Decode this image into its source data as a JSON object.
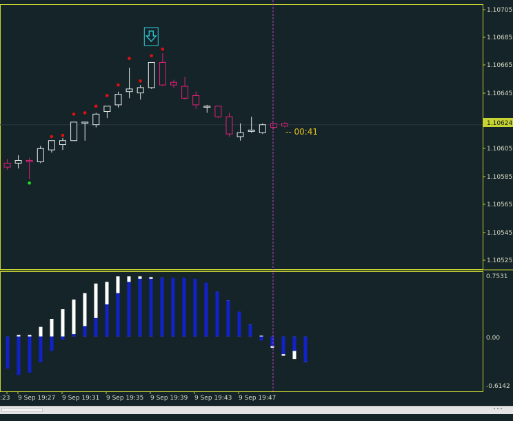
{
  "colors": {
    "background": "#152428",
    "frame": "#c8d432",
    "axis_text": "#d8dcc8",
    "bull": "#e8ecec",
    "bear": "#e0207a",
    "dot_red": "#e01010",
    "dot_green": "#20e020",
    "cursor": "#c040c0",
    "countdown": "#e0c020",
    "price_tag_bg": "#c8d432",
    "price_tag_text": "#0a1418",
    "hist_blue": "#1022c8",
    "hist_white": "#ffffff",
    "arrow": "#30d0e0"
  },
  "price_axis": {
    "labels": [
      "1.10705",
      "1.10685",
      "1.10665",
      "1.10645",
      "1.10624",
      "1.10605",
      "1.10585",
      "1.10565",
      "1.10545",
      "1.10525"
    ],
    "min": 1.10515,
    "max": 1.10715,
    "current_price": "1.10624",
    "current_value": 1.10624
  },
  "indicator_axis": {
    "labels": [
      "0.7531",
      "0.00",
      "-0.6142"
    ],
    "max": 0.7531,
    "min": -0.6142
  },
  "time_axis": {
    "labels": [
      ":23",
      "9 Sep 19:27",
      "9 Sep 19:31",
      "9 Sep 19:35",
      "9 Sep 19:39",
      "9 Sep 19:43",
      "9 Sep 19:47"
    ]
  },
  "countdown": "-- 00:41",
  "signal": {
    "type": "sell",
    "icon": "down-arrow-icon",
    "bar_index": 13
  },
  "candles": [
    {
      "o": 1.10595,
      "h": 1.10598,
      "l": 1.1059,
      "c": 1.10592
    },
    {
      "o": 1.10595,
      "h": 1.10601,
      "l": 1.10591,
      "c": 1.10597
    },
    {
      "o": 1.10597,
      "h": 1.10599,
      "l": 1.10583,
      "c": 1.10596
    },
    {
      "o": 1.10596,
      "h": 1.10608,
      "l": 1.10595,
      "c": 1.10606
    },
    {
      "o": 1.10605,
      "h": 1.10612,
      "l": 1.10603,
      "c": 1.10612
    },
    {
      "o": 1.10609,
      "h": 1.10614,
      "l": 1.10605,
      "c": 1.10612
    },
    {
      "o": 1.10612,
      "h": 1.10626,
      "l": 1.10612,
      "c": 1.10626
    },
    {
      "o": 1.10626,
      "h": 1.10626,
      "l": 1.10612,
      "c": 1.10626
    },
    {
      "o": 1.10624,
      "h": 1.10633,
      "l": 1.10622,
      "c": 1.10632
    },
    {
      "o": 1.10634,
      "h": 1.10638,
      "l": 1.10629,
      "c": 1.10638
    },
    {
      "o": 1.10639,
      "h": 1.10649,
      "l": 1.10637,
      "c": 1.10647
    },
    {
      "o": 1.10649,
      "h": 1.10667,
      "l": 1.10644,
      "c": 1.10651
    },
    {
      "o": 1.10648,
      "h": 1.10654,
      "l": 1.10643,
      "c": 1.10652
    },
    {
      "o": 1.10652,
      "h": 1.10671,
      "l": 1.10651,
      "c": 1.10671
    },
    {
      "o": 1.10671,
      "h": 1.10678,
      "l": 1.10653,
      "c": 1.10654
    },
    {
      "o": 1.10656,
      "h": 1.10658,
      "l": 1.10652,
      "c": 1.10654
    },
    {
      "o": 1.10653,
      "h": 1.1066,
      "l": 1.10643,
      "c": 1.10644
    },
    {
      "o": 1.10646,
      "h": 1.10649,
      "l": 1.10636,
      "c": 1.10639
    },
    {
      "o": 1.10638,
      "h": 1.10639,
      "l": 1.10633,
      "c": 1.10638
    },
    {
      "o": 1.10638,
      "h": 1.10638,
      "l": 1.10629,
      "c": 1.1063
    },
    {
      "o": 1.1063,
      "h": 1.10633,
      "l": 1.10615,
      "c": 1.10617
    },
    {
      "o": 1.10615,
      "h": 1.10625,
      "l": 1.10612,
      "c": 1.10618
    },
    {
      "o": 1.10619,
      "h": 1.1063,
      "l": 1.10618,
      "c": 1.1062
    },
    {
      "o": 1.10618,
      "h": 1.10625,
      "l": 1.10617,
      "c": 1.10624
    },
    {
      "o": 1.10625,
      "h": 1.10625,
      "l": 1.10621,
      "c": 1.10622
    },
    {
      "o": 1.10625,
      "h": 1.10626,
      "l": 1.10622,
      "c": 1.10623
    }
  ],
  "dots": [
    {
      "i": 1,
      "price": 1.1058,
      "color": "green"
    },
    {
      "i": 3,
      "price": 1.10615,
      "color": "red"
    },
    {
      "i": 4,
      "price": 1.10616,
      "color": "red"
    },
    {
      "i": 5,
      "price": 1.10632,
      "color": "red"
    },
    {
      "i": 6,
      "price": 1.10633,
      "color": "red"
    },
    {
      "i": 7,
      "price": 1.10638,
      "color": "red"
    },
    {
      "i": 8,
      "price": 1.10646,
      "color": "red"
    },
    {
      "i": 9,
      "price": 1.10654,
      "color": "red"
    },
    {
      "i": 10,
      "price": 1.10674,
      "color": "red"
    },
    {
      "i": 11,
      "price": 1.10657,
      "color": "red"
    },
    {
      "i": 12,
      "price": 1.10676,
      "color": "red"
    },
    {
      "i": 13,
      "price": 1.10681,
      "color": "red"
    }
  ],
  "histogram": {
    "blue": [
      -0.4,
      -0.48,
      -0.45,
      -0.32,
      -0.18,
      -0.04,
      0.03,
      0.13,
      0.23,
      0.4,
      0.54,
      0.68,
      0.72,
      0.72,
      0.73,
      0.73,
      0.73,
      0.72,
      0.67,
      0.56,
      0.45,
      0.31,
      0.15,
      -0.05,
      -0.12,
      -0.22,
      -0.18,
      -0.32
    ],
    "white": [
      0,
      0.02,
      0.02,
      0.12,
      0.22,
      0.34,
      0.46,
      0.54,
      0.66,
      0.68,
      0.75,
      0.75,
      0.75,
      0.74,
      0.73,
      0.72,
      0.7,
      0.68,
      0.66,
      0.56,
      0.45,
      0.31,
      0.15,
      0.01,
      -0.14,
      -0.24,
      -0.28,
      -0.32
    ]
  }
}
